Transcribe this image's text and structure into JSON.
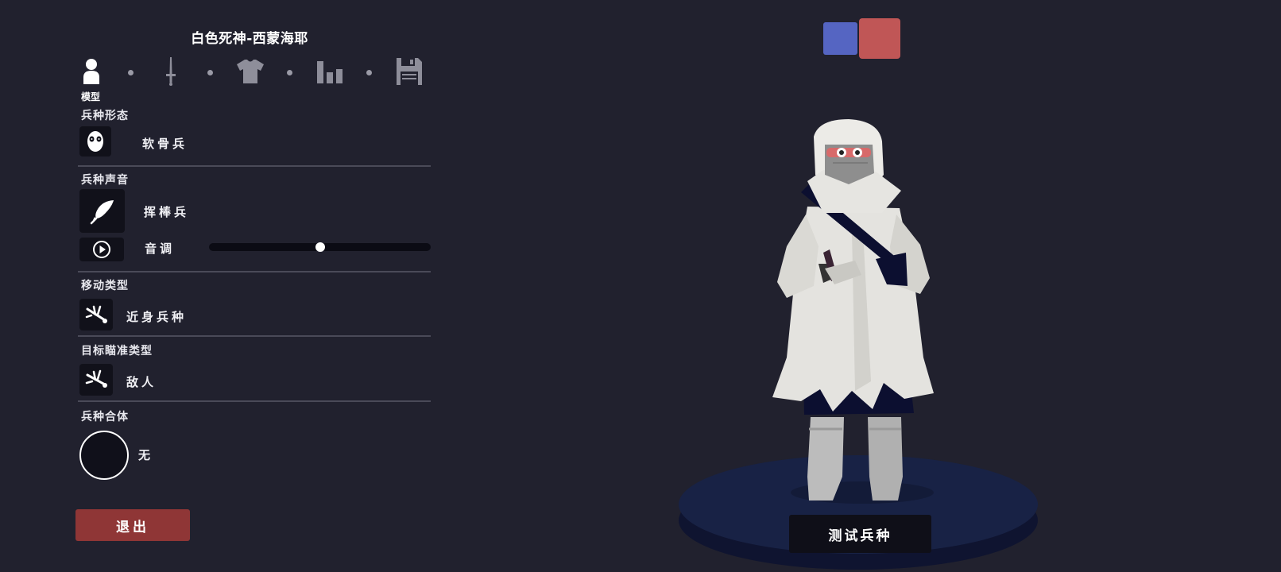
{
  "unit_name": "白色死神-西蒙海耶",
  "tabs": [
    {
      "icon": "person-icon",
      "label": "模型",
      "active": true
    },
    {
      "icon": "sword-icon",
      "active": false
    },
    {
      "icon": "shirt-icon",
      "active": false
    },
    {
      "icon": "stats-icon",
      "active": false
    },
    {
      "icon": "save-icon",
      "active": false
    }
  ],
  "sections": {
    "form": {
      "label": "兵种形态",
      "value": "软骨兵",
      "icon": "mask-icon"
    },
    "voice": {
      "label": "兵种声音",
      "value": "挥棒兵",
      "icon": "feather-icon",
      "pitch_label": "音调",
      "pitch_value": 0.5,
      "play_icon": "play-icon"
    },
    "movement": {
      "label": "移动类型",
      "value": "近身兵种",
      "icon": "melee-icon"
    },
    "targeting": {
      "label": "目标瞄准类型",
      "value": "敌人",
      "icon": "target-enemy-icon"
    },
    "combine": {
      "label": "兵种合体",
      "value": "无"
    }
  },
  "exit_label": "退出",
  "test_label": "测试兵种",
  "team_colors": {
    "blue": "#5565c2",
    "red": "#c05656"
  },
  "colors": {
    "background": "#21212e",
    "panel_box": "#11111a",
    "exit_red": "#8f3636"
  }
}
